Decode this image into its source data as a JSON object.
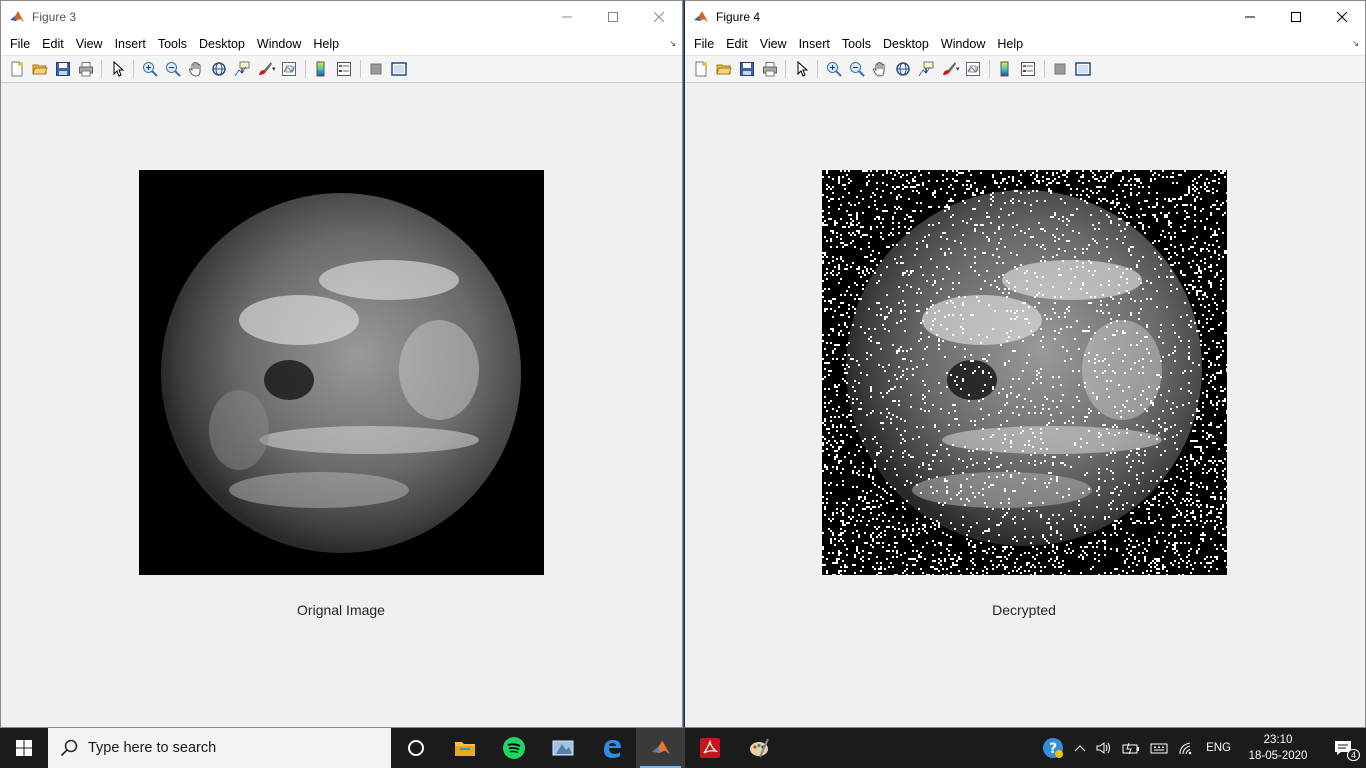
{
  "windows": [
    {
      "title": "Figure 3",
      "caption": "Orignal Image",
      "image_kind": "original-grayscale-earth"
    },
    {
      "title": "Figure 4",
      "caption": "Decrypted",
      "image_kind": "decrypted-noisy-earth"
    }
  ],
  "menu": [
    "File",
    "Edit",
    "View",
    "Insert",
    "Tools",
    "Desktop",
    "Window",
    "Help"
  ],
  "toolbar_icons": [
    "new-figure-icon",
    "open-file-icon",
    "save-icon",
    "print-icon",
    "edit-plot-icon",
    "zoom-in-icon",
    "zoom-out-icon",
    "pan-icon",
    "rotate-3d-icon",
    "data-cursor-icon",
    "brush-icon",
    "link-plot-icon",
    "insert-colorbar-icon",
    "insert-legend-icon",
    "hide-plot-tools-icon",
    "show-plot-tools-icon"
  ],
  "taskbar": {
    "search_placeholder": "Type here to search",
    "apps": [
      "cortana-icon",
      "file-explorer-icon",
      "spotify-icon",
      "snipping-tool-icon",
      "edge-icon",
      "matlab-icon",
      "acrobat-icon",
      "paint-icon"
    ],
    "active_app": "matlab-icon"
  },
  "tray": {
    "language": "ENG",
    "time": "23:10",
    "date": "18-05-2020",
    "notification_count": "4"
  },
  "colors": {
    "taskbar_bg": "#1b1b1b",
    "window_bg": "#f0f0f0",
    "accent": "#76b9ed"
  }
}
